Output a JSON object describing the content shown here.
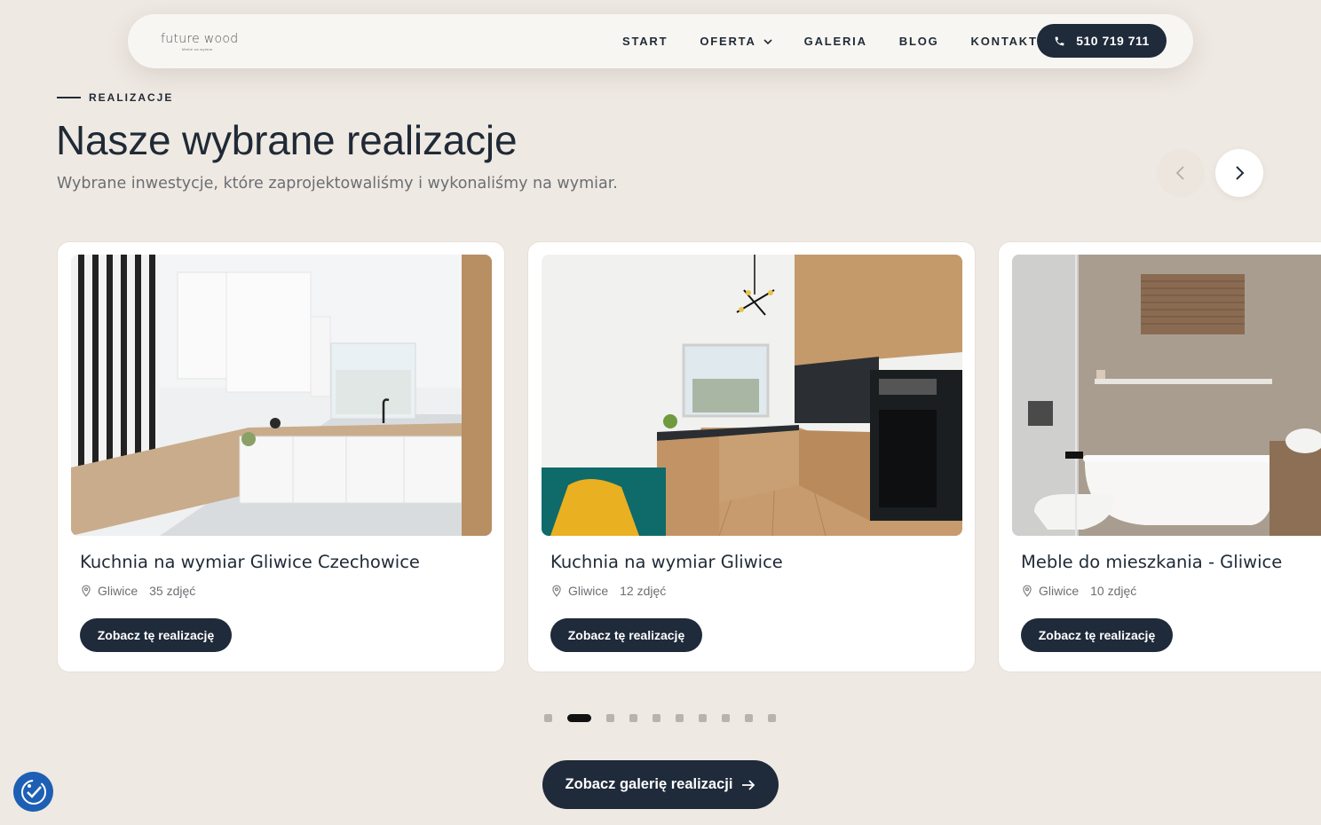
{
  "header": {
    "logo_main": "future wood",
    "logo_sub": "Meble na wymiar",
    "menu": [
      {
        "label": "START"
      },
      {
        "label": "OFERTA"
      },
      {
        "label": "GALERIA"
      },
      {
        "label": "BLOG"
      },
      {
        "label": "KONTAKT"
      }
    ],
    "phone": "510 719 711"
  },
  "section": {
    "eyebrow": "REALIZACJE",
    "title": "Nasze wybrane realizacje",
    "subtitle": "Wybrane inwestycje, które zaprojektowaliśmy i wykonaliśmy na wymiar."
  },
  "cards": [
    {
      "title": "Kuchnia na wymiar Gliwice Czechowice",
      "city": "Gliwice",
      "photos": "35 zdjęć",
      "button": "Zobacz tę realizację"
    },
    {
      "title": "Kuchnia na wymiar Gliwice",
      "city": "Gliwice",
      "photos": "12 zdjęć",
      "button": "Zobacz tę realizację"
    },
    {
      "title": "Meble do mieszkania - Gliwice",
      "city": "Gliwice",
      "photos": "10 zdjęć",
      "button": "Zobacz tę realizację"
    }
  ],
  "carousel": {
    "total_dots": 10,
    "active_dot": 2
  },
  "gallery_button": "Zobacz galerię realizacji",
  "colors": {
    "background": "#efe9e3",
    "primary": "#1f2a3a",
    "accessibility": "#1d5fb4"
  },
  "icons": [
    "phone-icon",
    "chevron-down-icon",
    "chevron-left-icon",
    "chevron-right-icon",
    "map-pin-icon",
    "arrow-right-icon",
    "accessibility-icon"
  ]
}
